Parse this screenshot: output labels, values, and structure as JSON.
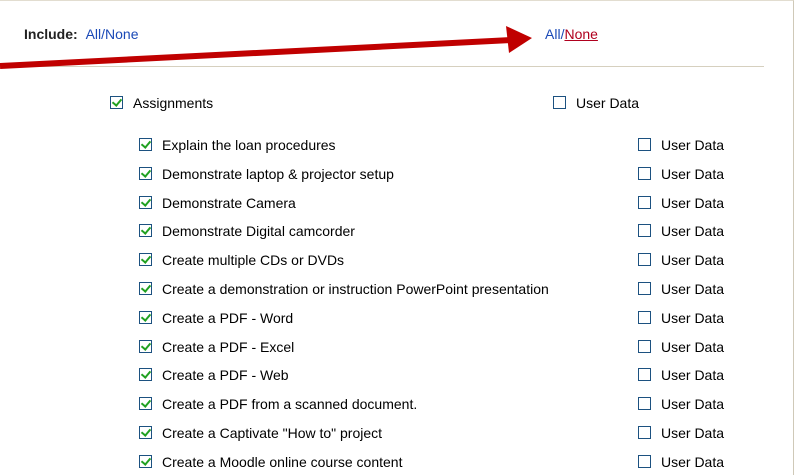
{
  "include": {
    "label": "Include:",
    "all_none": "All/None"
  },
  "right_links": {
    "all": "All",
    "separator": "/",
    "none": "None"
  },
  "section": {
    "label": "Assignments",
    "checked": true,
    "user_data_label": "User Data",
    "user_data_checked": false
  },
  "items": [
    {
      "label": "Explain the loan procedures",
      "checked": true,
      "user_data": "User Data",
      "user_data_checked": false
    },
    {
      "label": "Demonstrate laptop & projector setup",
      "checked": true,
      "user_data": "User Data",
      "user_data_checked": false
    },
    {
      "label": "Demonstrate Camera",
      "checked": true,
      "user_data": "User Data",
      "user_data_checked": false
    },
    {
      "label": "Demonstrate Digital camcorder",
      "checked": true,
      "user_data": "User Data",
      "user_data_checked": false
    },
    {
      "label": "Create multiple CDs or DVDs",
      "checked": true,
      "user_data": "User Data",
      "user_data_checked": false
    },
    {
      "label": "Create a demonstration or instruction PowerPoint presentation",
      "checked": true,
      "user_data": "User Data",
      "user_data_checked": false
    },
    {
      "label": "Create a PDF - Word",
      "checked": true,
      "user_data": "User Data",
      "user_data_checked": false
    },
    {
      "label": "Create a PDF - Excel",
      "checked": true,
      "user_data": "User Data",
      "user_data_checked": false
    },
    {
      "label": "Create a PDF - Web",
      "checked": true,
      "user_data": "User Data",
      "user_data_checked": false
    },
    {
      "label": "Create a PDF from a scanned document.",
      "checked": true,
      "user_data": "User Data",
      "user_data_checked": false
    },
    {
      "label": "Create a Captivate \"How to\" project",
      "checked": true,
      "user_data": "User Data",
      "user_data_checked": false
    },
    {
      "label": "Create a Moodle online course content",
      "checked": true,
      "user_data": "User Data",
      "user_data_checked": false
    }
  ],
  "colors": {
    "link": "#1a49b7",
    "none_link": "#b0001e",
    "arrow": "#c00000",
    "check": "#21a121",
    "checkbox_border": "#1c5180"
  }
}
